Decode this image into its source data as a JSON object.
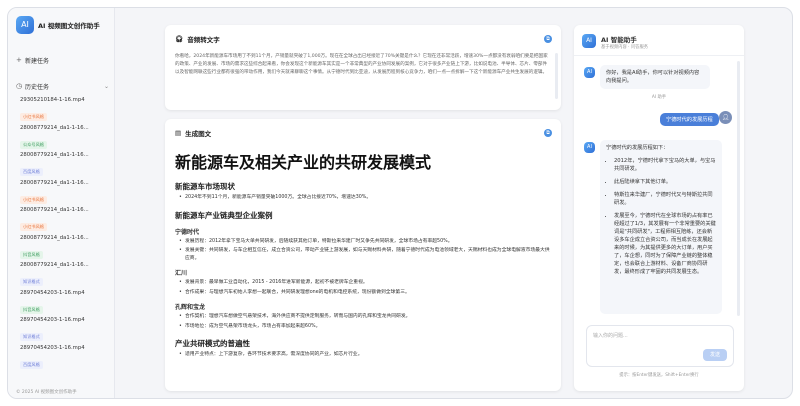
{
  "app": {
    "title": "AI 视频图文创作助手",
    "footer": "© 2025 AI 视频图文创作助手"
  },
  "sidebar": {
    "new_task": "新建任务",
    "history_label": "历史任务",
    "items": [
      {
        "name": "29305210184-1-16.mp4",
        "tag": "小红书风格",
        "tag_color": "#e8743b",
        "tag_bg": "#fdece3"
      },
      {
        "name": "28008779214_da1-1-16...",
        "tag": "公众号风格",
        "tag_color": "#3a9b5c",
        "tag_bg": "#e5f5ea"
      },
      {
        "name": "28008779214_da1-1-16...",
        "tag": "百度风格",
        "tag_color": "#6b7bd6",
        "tag_bg": "#eceffc"
      },
      {
        "name": "28008779214_da1-1-16...",
        "tag": "小红书风格",
        "tag_color": "#e8743b",
        "tag_bg": "#fdece3"
      },
      {
        "name": "28008779214_da1-1-16...",
        "tag": "小红书风格",
        "tag_color": "#e8743b",
        "tag_bg": "#fdece3"
      },
      {
        "name": "28008779214_da1-1-16...",
        "tag": "抖音风格",
        "tag_color": "#3a9b5c",
        "tag_bg": "#e5f5ea"
      },
      {
        "name": "28008779214_da1-1-16...",
        "tag": "知识格式",
        "tag_color": "#6b7bd6",
        "tag_bg": "#eceffc"
      },
      {
        "name": "28970454203-1-16.mp4",
        "tag": "抖音风格",
        "tag_color": "#3a9b5c",
        "tag_bg": "#e5f5ea"
      },
      {
        "name": "28970454203-1-16.mp4",
        "tag": "知识格式",
        "tag_color": "#6b7bd6",
        "tag_bg": "#eceffc"
      },
      {
        "name": "28970454203-1-16.mp4",
        "tag": "百度风格",
        "tag_color": "#6b7bd6",
        "tag_bg": "#eceffc"
      }
    ]
  },
  "transcript": {
    "title": "音频转文字",
    "text": "你看哈，2024年新能源车市场用了不到11个月，产销量就突破了1,000万。现在在全球占出已经接近了70%关键是什么？它现在还非常活跃，增速30%一点都没有衰弱咱们要是把国家的政策、产业的发展、市场的需求这些综合起来看，你会发现这个新能源车其实是一个非常典型的产业协同发展的案例，它对于很多产业链上下游，比如说电池、半导体、芯片、零部件以及智能网联这些行业都有很强的带动作用，我们今天就来聊聊这个事情。从宁德时代到比亚迪，从发展历程到核心竞争力，咱们一点一点拆解一下这个新能源车产业共生发展的逻辑。"
  },
  "article": {
    "section_title": "生成图文",
    "h1": "新能源车及相关产业的共研发展模式",
    "h2_market": "新能源车市场现状",
    "market_point": "2024年不到11个月，新能源车产销量突破1000万。全球占比接近70%，增速达30%。",
    "h2_case": "新能源车产业链典型企业案例",
    "c1": "宁德时代",
    "c1_p1": "发展历程：2012年拿下宝马大单共同研发，后随续获其他订单，特斯拉来华建厂时又争先共同研发，全球市场占有率超50%。",
    "c1_p2": "发展关键：共同研发，与车企相互信任，成立合资公司，带动产业链上游发展，如与天赐材料共研，随着宁德时代成为电池领域老大，天赐材料也成为全球电解液市场最大供应商。",
    "c2": "汇川",
    "c2_p1": "发展背景：最早做工业自动化，2015 - 2016年进军新能源，起初不被老牌车企重视。",
    "c2_p2": "合作成果：与理想汽车初始人李想一起联合，共同研发理想one的电机和电控系统，现份额做到全球第三。",
    "c3": "孔辉和宝龙",
    "c3_p1": "合作契机：理想汽车想做空气悬架技术，海外供应商不提供定制服务，转而与国内的孔辉和宝龙共同研发。",
    "c3_p2": "市场地位：成为空气悬架市场龙头，市场占有率加起来超60%。",
    "h2_common": "产业共研模式的普遍性",
    "common_p1": "适用产业特点：上下游复杂，各环节技术要求高，需深度协同的产业，如芯片行业。"
  },
  "chat": {
    "title": "AI 智能助手",
    "subtitle": "基于视频内容 · 问答服务",
    "greeting": "你好，我是AI助手，你可以针对视频内容向我提问。",
    "assistant_label": "AI 助手",
    "user_msg": "宁德时代的发展历程",
    "answer_intro": "宁德时代的发展历程如下：",
    "answer_points": [
      "2012年，宁德时代拿下宝马的大单，与宝马共同研发。",
      "此后陆续拿下其他订单。",
      "特斯拉来华建厂，宁德时代又与特斯拉共同研发。",
      "发展至今，宁德时代在全球市场的占有率已经超过了1/3，其发展有一个非常重要的关键词是\"共同研发\"，工程师相互陪练，还会新设多车企成立合资公司，而当成长在发展起来的时候，为其提供更多的大订单，用户买了，车企想，同时为了保障产业链的整体稳定，也会联合上游材料、设备厂商协同研发，最终形成了牢固的共同发展生态。"
    ],
    "input_placeholder": "输入你的问题...",
    "send_label": "发送",
    "hint": "提示：按Enter键发送，Shift+Enter换行"
  }
}
